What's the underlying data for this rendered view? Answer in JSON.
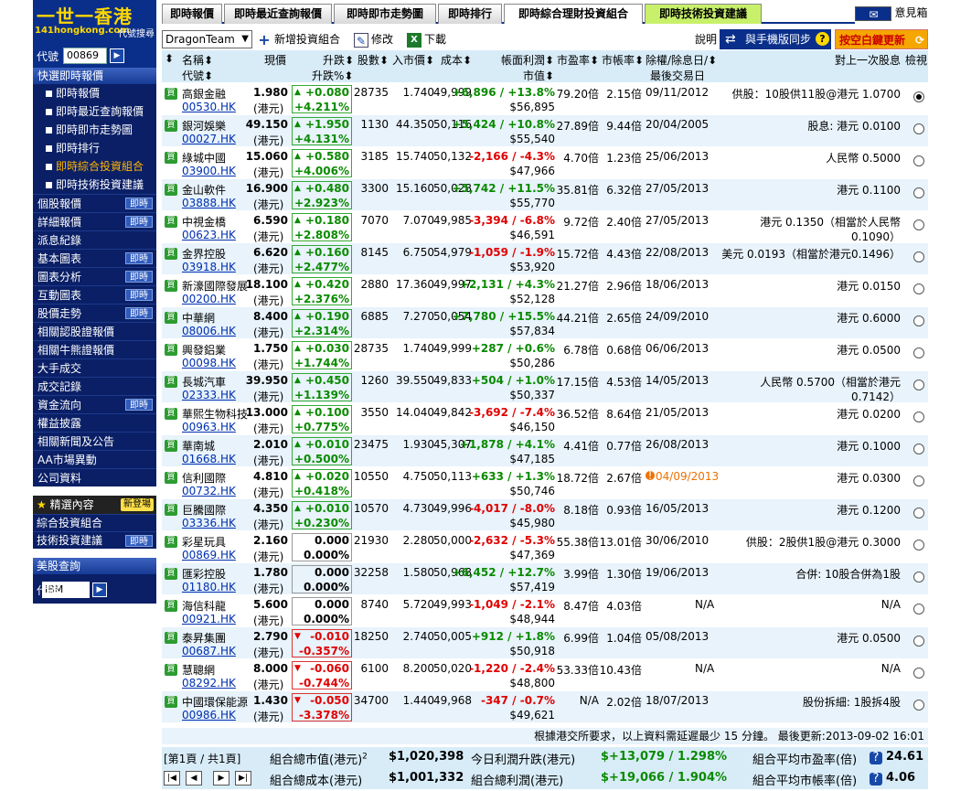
{
  "sidebar": {
    "logo_title": "一世一香港",
    "logo_url": "141hongkong.com",
    "logo_search": "代號搜尋",
    "code_label": "代號",
    "code_value": "00869",
    "section_title": "快選即時報價",
    "sub_items": [
      "即時報價",
      "即時最近查詢報價",
      "即時即市走勢圖",
      "即時排行",
      "即時綜合投資組合",
      "即時技術投資建議"
    ],
    "nav_items": [
      {
        "label": "個股報價",
        "badge": "即時"
      },
      {
        "label": "詳細報價",
        "badge": "即時"
      },
      {
        "label": "派息紀錄",
        "badge": ""
      },
      {
        "label": "基本圖表",
        "badge": "即時"
      },
      {
        "label": "圖表分析",
        "badge": "即時"
      },
      {
        "label": "互動圖表",
        "badge": "即時"
      },
      {
        "label": "股價走勢",
        "badge": "即時"
      },
      {
        "label": "相關認股證報價",
        "badge": ""
      },
      {
        "label": "相關牛熊證報價",
        "badge": ""
      },
      {
        "label": "大手成交",
        "badge": ""
      },
      {
        "label": "成交記錄",
        "badge": ""
      },
      {
        "label": "資金流向",
        "badge": "即時"
      },
      {
        "label": "權益披露",
        "badge": ""
      },
      {
        "label": "相關新聞及公告",
        "badge": ""
      },
      {
        "label": "AA市場異動",
        "badge": ""
      },
      {
        "label": "公司資料",
        "badge": ""
      }
    ],
    "featured_title": "精選內容",
    "featured_new": "新登場",
    "featured_items": [
      {
        "label": "綜合投資組合",
        "badge": ""
      },
      {
        "label": "技術投資建議",
        "badge": "即時"
      }
    ],
    "us_title": "美股查詢",
    "us_code_label": "代號",
    "us_code_value": "IBM"
  },
  "tabs": [
    "即時報價",
    "即時最近查詢報價",
    "即時即市走勢圖",
    "即時排行",
    "即時綜合理財投資組合",
    "即時技術投資建議"
  ],
  "mail_label": "意見箱",
  "toolbar": {
    "portfolio": "DragonTeam",
    "add": "新增投資組合",
    "edit": "修改",
    "download": "下載",
    "help": "說明",
    "sync": "與手機版同步",
    "update": "按空白鍵更新"
  },
  "headers": {
    "name": "名稱",
    "code": "代號",
    "price": "現價",
    "change": "升跌",
    "change_pct": "升跌%",
    "shares": "股數",
    "buy_price": "入市價",
    "cost": "成本",
    "book_pl": "帳面利潤",
    "market_value": "市值",
    "pe": "市盈率",
    "pb": "市帳率",
    "exdate": "除權/除息日/",
    "last_trade": "最後交易日",
    "last_div": "對上一次股息",
    "view": "檢視"
  },
  "rows": [
    {
      "name": "高銀金融",
      "code": "00530.HK",
      "price": "1.980",
      "chg": "+0.080",
      "chgp": "+4.211%",
      "dir": "up",
      "shares": "28735",
      "buyp": "1.740",
      "cost": "49,999",
      "pl": "+6,896 / +13.8%",
      "pldir": "up",
      "mv": "$56,895",
      "pe": "79.20倍",
      "pb": "2.15倍",
      "date": "09/11/2012",
      "warn": false,
      "div1": "供股：10股供11股@港元 1.0700",
      "div2": "",
      "checked": true
    },
    {
      "name": "銀河娛樂",
      "code": "00027.HK",
      "price": "49.150",
      "chg": "+1.950",
      "chgp": "+4.131%",
      "dir": "up",
      "shares": "1130",
      "buyp": "44.350",
      "cost": "50,116",
      "pl": "+5,424 / +10.8%",
      "pldir": "up",
      "mv": "$55,540",
      "pe": "27.89倍",
      "pb": "9.44倍",
      "date": "20/04/2005",
      "warn": false,
      "div1": "股息: 港元 0.0100",
      "div2": "",
      "checked": false
    },
    {
      "name": "綠城中國",
      "code": "03900.HK",
      "price": "15.060",
      "chg": "+0.580",
      "chgp": "+4.006%",
      "dir": "up",
      "shares": "3185",
      "buyp": "15.740",
      "cost": "50,132",
      "pl": "-2,166 / -4.3%",
      "pldir": "down",
      "mv": "$47,966",
      "pe": "4.70倍",
      "pb": "1.23倍",
      "date": "25/06/2013",
      "warn": false,
      "div1": "人民幣 0.5000",
      "div2": "",
      "checked": false
    },
    {
      "name": "金山軟件",
      "code": "03888.HK",
      "price": "16.900",
      "chg": "+0.480",
      "chgp": "+2.923%",
      "dir": "up",
      "shares": "3300",
      "buyp": "15.160",
      "cost": "50,028",
      "pl": "+5,742 / +11.5%",
      "pldir": "up",
      "mv": "$55,770",
      "pe": "35.81倍",
      "pb": "6.32倍",
      "date": "27/05/2013",
      "warn": false,
      "div1": "港元 0.1100",
      "div2": "",
      "checked": false
    },
    {
      "name": "中視金橋",
      "code": "00623.HK",
      "price": "6.590",
      "chg": "+0.180",
      "chgp": "+2.808%",
      "dir": "up",
      "shares": "7070",
      "buyp": "7.070",
      "cost": "49,985",
      "pl": "-3,394 / -6.8%",
      "pldir": "down",
      "mv": "$46,591",
      "pe": "9.72倍",
      "pb": "2.40倍",
      "date": "27/05/2013",
      "warn": false,
      "div1": "港元 0.1350（相當於人民幣",
      "div2": "0.1090）",
      "checked": false
    },
    {
      "name": "金界控股",
      "code": "03918.HK",
      "price": "6.620",
      "chg": "+0.160",
      "chgp": "+2.477%",
      "dir": "up",
      "shares": "8145",
      "buyp": "6.750",
      "cost": "54,979",
      "pl": "-1,059 / -1.9%",
      "pldir": "down",
      "mv": "$53,920",
      "pe": "15.72倍",
      "pb": "4.43倍",
      "date": "22/08/2013",
      "warn": false,
      "div1": "美元 0.0193（相當於港元0.1496）",
      "div2": "",
      "checked": false
    },
    {
      "name": "新濠國際發展",
      "code": "00200.HK",
      "price": "18.100",
      "chg": "+0.420",
      "chgp": "+2.376%",
      "dir": "up",
      "shares": "2880",
      "buyp": "17.360",
      "cost": "49,997",
      "pl": "+2,131 / +4.3%",
      "pldir": "up",
      "mv": "$52,128",
      "pe": "21.27倍",
      "pb": "2.96倍",
      "date": "18/06/2013",
      "warn": false,
      "div1": "港元 0.0150",
      "div2": "",
      "checked": false
    },
    {
      "name": "中華網",
      "code": "08006.HK",
      "price": "8.400",
      "chg": "+0.190",
      "chgp": "+2.314%",
      "dir": "up",
      "shares": "6885",
      "buyp": "7.270",
      "cost": "50,054",
      "pl": "+7,780 / +15.5%",
      "pldir": "up",
      "mv": "$57,834",
      "pe": "44.21倍",
      "pb": "2.65倍",
      "date": "24/09/2010",
      "warn": false,
      "div1": "港元 0.6000",
      "div2": "",
      "checked": false
    },
    {
      "name": "興發鋁業",
      "code": "00098.HK",
      "price": "1.750",
      "chg": "+0.030",
      "chgp": "+1.744%",
      "dir": "up",
      "shares": "28735",
      "buyp": "1.740",
      "cost": "49,999",
      "pl": "+287 / +0.6%",
      "pldir": "up",
      "mv": "$50,286",
      "pe": "6.78倍",
      "pb": "0.68倍",
      "date": "06/06/2013",
      "warn": false,
      "div1": "港元 0.0500",
      "div2": "",
      "checked": false
    },
    {
      "name": "長城汽車",
      "code": "02333.HK",
      "price": "39.950",
      "chg": "+0.450",
      "chgp": "+1.139%",
      "dir": "up",
      "shares": "1260",
      "buyp": "39.550",
      "cost": "49,833",
      "pl": "+504 / +1.0%",
      "pldir": "up",
      "mv": "$50,337",
      "pe": "17.15倍",
      "pb": "4.53倍",
      "date": "14/05/2013",
      "warn": false,
      "div1": "人民幣 0.5700（相當於港元",
      "div2": "0.7142）",
      "checked": false
    },
    {
      "name": "華熙生物科技",
      "code": "00963.HK",
      "price": "13.000",
      "chg": "+0.100",
      "chgp": "+0.775%",
      "dir": "up",
      "shares": "3550",
      "buyp": "14.040",
      "cost": "49,842",
      "pl": "-3,692 / -7.4%",
      "pldir": "down",
      "mv": "$46,150",
      "pe": "36.52倍",
      "pb": "8.64倍",
      "date": "21/05/2013",
      "warn": false,
      "div1": "港元 0.0200",
      "div2": "",
      "checked": false
    },
    {
      "name": "華南城",
      "code": "01668.HK",
      "price": "2.010",
      "chg": "+0.010",
      "chgp": "+0.500%",
      "dir": "up",
      "shares": "23475",
      "buyp": "1.930",
      "cost": "45,307",
      "pl": "+1,878 / +4.1%",
      "pldir": "up",
      "mv": "$47,185",
      "pe": "4.41倍",
      "pb": "0.77倍",
      "date": "26/08/2013",
      "warn": false,
      "div1": "港元 0.1000",
      "div2": "",
      "checked": false
    },
    {
      "name": "信利國際",
      "code": "00732.HK",
      "price": "4.810",
      "chg": "+0.020",
      "chgp": "+0.418%",
      "dir": "up",
      "shares": "10550",
      "buyp": "4.750",
      "cost": "50,113",
      "pl": "+633 / +1.3%",
      "pldir": "up",
      "mv": "$50,746",
      "pe": "18.72倍",
      "pb": "2.67倍",
      "date": "04/09/2013",
      "warn": true,
      "div1": "港元 0.0300",
      "div2": "",
      "checked": false
    },
    {
      "name": "巨騰國際",
      "code": "03336.HK",
      "price": "4.350",
      "chg": "+0.010",
      "chgp": "+0.230%",
      "dir": "up",
      "shares": "10570",
      "buyp": "4.730",
      "cost": "49,996",
      "pl": "-4,017 / -8.0%",
      "pldir": "down",
      "mv": "$45,980",
      "pe": "8.18倍",
      "pb": "0.93倍",
      "date": "16/05/2013",
      "warn": false,
      "div1": "港元 0.1200",
      "div2": "",
      "checked": false
    },
    {
      "name": "彩星玩具",
      "code": "00869.HK",
      "price": "2.160",
      "chg": "0.000",
      "chgp": "0.000%",
      "dir": "zero",
      "shares": "21930",
      "buyp": "2.280",
      "cost": "50,000",
      "pl": "-2,632 / -5.3%",
      "pldir": "down",
      "mv": "$47,369",
      "pe": "55.38倍",
      "pb": "13.01倍",
      "date": "30/06/2010",
      "warn": false,
      "div1": "供股：2股供1股@港元 0.3000",
      "div2": "",
      "checked": false
    },
    {
      "name": "匯彩控股",
      "code": "01180.HK",
      "price": "1.780",
      "chg": "0.000",
      "chgp": "0.000%",
      "dir": "zero",
      "shares": "32258",
      "buyp": "1.580",
      "cost": "50,968",
      "pl": "+6,452 / +12.7%",
      "pldir": "up",
      "mv": "$57,419",
      "pe": "3.99倍",
      "pb": "1.30倍",
      "date": "19/06/2013",
      "warn": false,
      "div1": "合併: 10股合併為1股",
      "div2": "",
      "checked": false
    },
    {
      "name": "海信科龍",
      "code": "00921.HK",
      "price": "5.600",
      "chg": "0.000",
      "chgp": "0.000%",
      "dir": "zero",
      "shares": "8740",
      "buyp": "5.720",
      "cost": "49,993",
      "pl": "-1,049 / -2.1%",
      "pldir": "down",
      "mv": "$48,944",
      "pe": "8.47倍",
      "pb": "4.03倍",
      "date": "N/A",
      "warn": false,
      "div1": "N/A",
      "div2": "",
      "checked": false
    },
    {
      "name": "泰昇集團",
      "code": "00687.HK",
      "price": "2.790",
      "chg": "-0.010",
      "chgp": "-0.357%",
      "dir": "down",
      "shares": "18250",
      "buyp": "2.740",
      "cost": "50,005",
      "pl": "+912 / +1.8%",
      "pldir": "up",
      "mv": "$50,918",
      "pe": "6.99倍",
      "pb": "1.04倍",
      "date": "05/08/2013",
      "warn": false,
      "div1": "港元 0.0500",
      "div2": "",
      "checked": false
    },
    {
      "name": "慧聰網",
      "code": "08292.HK",
      "price": "8.000",
      "chg": "-0.060",
      "chgp": "-0.744%",
      "dir": "down",
      "shares": "6100",
      "buyp": "8.200",
      "cost": "50,020",
      "pl": "-1,220 / -2.4%",
      "pldir": "down",
      "mv": "$48,800",
      "pe": "53.33倍",
      "pb": "10.43倍",
      "date": "N/A",
      "warn": false,
      "div1": "N/A",
      "div2": "",
      "checked": false
    },
    {
      "name": "中國環保能源",
      "code": "00986.HK",
      "price": "1.430",
      "chg": "-0.050",
      "chgp": "-3.378%",
      "dir": "down",
      "shares": "34700",
      "buyp": "1.440",
      "cost": "49,968",
      "pl": "-347 / -0.7%",
      "pldir": "down",
      "mv": "$49,621",
      "pe": "N/A",
      "pb": "2.02倍",
      "date": "18/07/2013",
      "warn": false,
      "div1": "股份拆細: 1股拆4股",
      "div2": "",
      "checked": false
    }
  ],
  "hk_unit": "(港元)",
  "buy_label": "買",
  "note": "根據港交所要求，以上資料需延遲最少 15 分鐘。 最後更新:2013-09-02 16:01",
  "footer": {
    "page": "[第1頁 / 共1頁]",
    "mv_label": "組合總市值(港元)",
    "mv_sup": "2",
    "mv_value": "$1,020,398",
    "cost_label": "組合總成本(港元)",
    "cost_value": "$1,001,332",
    "today_label": "今日利潤升跌(港元)",
    "today_value": "$+13,079 / 1.298%",
    "total_label": "組合總利潤(港元)",
    "total_value": "$+19,066 / 1.904%",
    "pe_label": "組合平均市盈率(倍)",
    "pe_value": "24.61",
    "pb_label": "組合平均市帳率(倍)",
    "pb_value": "4.06"
  }
}
